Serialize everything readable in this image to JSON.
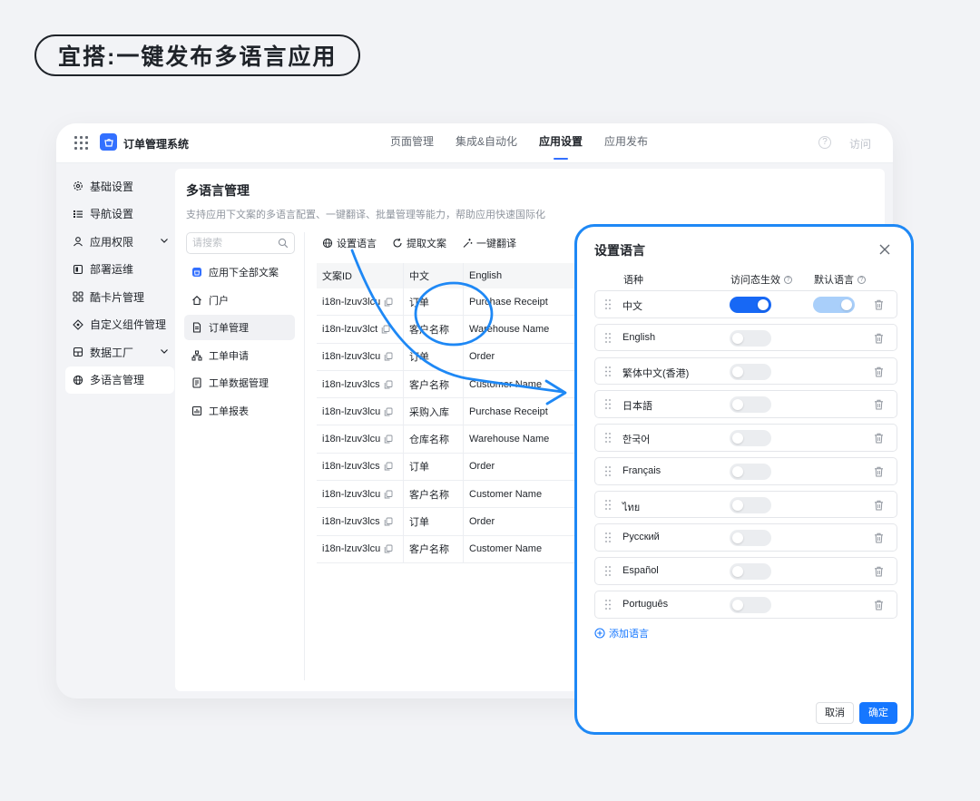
{
  "hero": {
    "title": "宜搭:一键发布多语言应用"
  },
  "topbar": {
    "app_name": "订单管理系统",
    "tabs": [
      {
        "label": "页面管理",
        "active": false
      },
      {
        "label": "集成&自动化",
        "active": false
      },
      {
        "label": "应用设置",
        "active": true
      },
      {
        "label": "应用发布",
        "active": false
      }
    ],
    "help": "?",
    "visit": "访问"
  },
  "sidebar": {
    "items": [
      {
        "label": "基础设置",
        "icon": "gear-icon"
      },
      {
        "label": "导航设置",
        "icon": "list-icon"
      },
      {
        "label": "应用权限",
        "icon": "user-icon",
        "expandable": true
      },
      {
        "label": "部署运维",
        "icon": "deploy-icon"
      },
      {
        "label": "酷卡片管理",
        "icon": "card-icon"
      },
      {
        "label": "自定义组件管理",
        "icon": "component-icon"
      },
      {
        "label": "数据工厂",
        "icon": "database-icon",
        "expandable": true
      },
      {
        "label": "多语言管理",
        "icon": "globe-icon",
        "active": true
      }
    ]
  },
  "main": {
    "title": "多语言管理",
    "description": "支持应用下文案的多语言配置、一键翻译、批量管理等能力，帮助应用快速国际化",
    "search_placeholder": "请搜索",
    "subnav": [
      {
        "label": "应用下全部文案",
        "icon": "app-icon"
      },
      {
        "label": "门户",
        "icon": "home-icon"
      },
      {
        "label": "订单管理",
        "icon": "doc-icon",
        "active": true
      },
      {
        "label": "工单申请",
        "icon": "org-icon"
      },
      {
        "label": "工单数据管理",
        "icon": "form-icon"
      },
      {
        "label": "工单报表",
        "icon": "report-icon"
      }
    ],
    "toolbar": {
      "set_language": "设置语言",
      "extract_text": "提取文案",
      "one_click_translate": "一键翻译"
    },
    "table": {
      "headers": [
        "文案ID",
        "中文",
        "English"
      ],
      "rows": [
        {
          "id": "i18n-lzuv3lcu",
          "zh": "订单",
          "en": "Purchase Receipt"
        },
        {
          "id": "i18n-lzuv3lct",
          "zh": "客户名称",
          "en": "Warehouse Name"
        },
        {
          "id": "i18n-lzuv3lcu",
          "zh": "订单",
          "en": "Order"
        },
        {
          "id": "i18n-lzuv3lcs",
          "zh": "客户名称",
          "en": "Customer Name"
        },
        {
          "id": "i18n-lzuv3lcu",
          "zh": "采购入库",
          "en": "Purchase Receipt"
        },
        {
          "id": "i18n-lzuv3lcu",
          "zh": "仓库名称",
          "en": "Warehouse Name"
        },
        {
          "id": "i18n-lzuv3lcs",
          "zh": "订单",
          "en": "Order"
        },
        {
          "id": "i18n-lzuv3lcu",
          "zh": "客户名称",
          "en": "Customer Name"
        },
        {
          "id": "i18n-lzuv3lcs",
          "zh": "订单",
          "en": "Order"
        },
        {
          "id": "i18n-lzuv3lcu",
          "zh": "客户名称",
          "en": "Customer Name"
        }
      ]
    }
  },
  "dialog": {
    "title": "设置语言",
    "headers": {
      "language": "语种",
      "visit_state": "访问态生效",
      "default_language": "默认语言"
    },
    "languages": [
      {
        "name": "中文",
        "enabled": true,
        "default": true
      },
      {
        "name": "English",
        "enabled": false
      },
      {
        "name": "繁体中文(香港)",
        "enabled": false
      },
      {
        "name": "日本語",
        "enabled": false
      },
      {
        "name": "한국어",
        "enabled": false
      },
      {
        "name": "Français",
        "enabled": false
      },
      {
        "name": "ไทย",
        "enabled": false
      },
      {
        "name": "Русский",
        "enabled": false
      },
      {
        "name": "Español",
        "enabled": false
      },
      {
        "name": "Português",
        "enabled": false
      }
    ],
    "add_language": "添加语言",
    "cancel": "取消",
    "confirm": "确定"
  },
  "colors": {
    "accent": "#1677ff",
    "annotation": "#1e88f5",
    "toggle_off": "#ebedf0",
    "toggle_default": "#a9cffa"
  }
}
